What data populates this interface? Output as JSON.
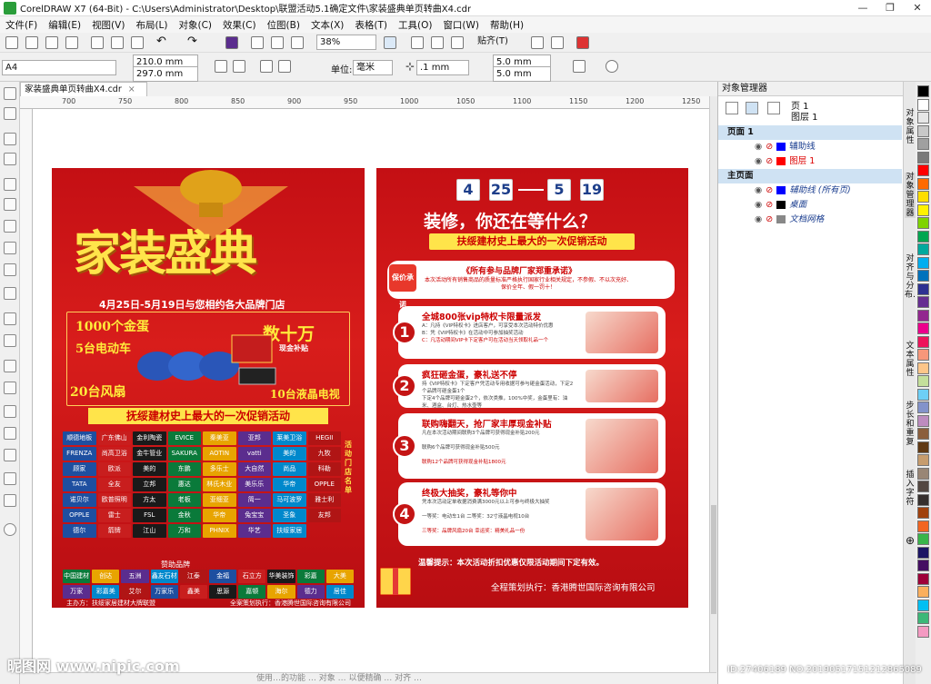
{
  "window": {
    "title": "CorelDRAW X7 (64-Bit) - C:\\Users\\Administrator\\Desktop\\联盟活动5.1确定文件\\家装盛典单页转曲X4.cdr",
    "minimize": "—",
    "restore": "❐",
    "close": "✕"
  },
  "menu": [
    "文件(F)",
    "编辑(E)",
    "视图(V)",
    "布局(L)",
    "对象(C)",
    "效果(C)",
    "位图(B)",
    "文本(X)",
    "表格(T)",
    "工具(O)",
    "窗口(W)",
    "帮助(H)"
  ],
  "toolbar": {
    "zoom": "38%",
    "snap": "贴齐(T)"
  },
  "propbar": {
    "page_size": "A4",
    "width": "210.0 mm",
    "height": "297.0 mm",
    "units_label": "单位:",
    "units": "毫米",
    "nudge": ".1 mm",
    "dup_x": "5.0 mm",
    "dup_y": "5.0 mm"
  },
  "document_tab": "家装盛典单页转曲X4.cdr",
  "ruler_ticks": [
    "700",
    "750",
    "800",
    "850",
    "900",
    "950",
    "1000",
    "1050",
    "1100",
    "1150",
    "1200",
    "1250"
  ],
  "status_text": "使用…的功能 … 对象 … 以便精确 … 对齐 …",
  "object_manager": {
    "title": "对象管理器",
    "page_label": "页 1",
    "layer_label": "图层 1",
    "rows": [
      {
        "name": "页面 1",
        "bold": true,
        "selected": true
      },
      {
        "name": "辅助线",
        "color": "#0000ff"
      },
      {
        "name": "图层 1",
        "color": "#ff0000",
        "red": true
      },
      {
        "name": "主页面",
        "bold": true,
        "selected": true
      },
      {
        "name": "辅助线 (所有页)",
        "color": "#0000ff",
        "italic": true
      },
      {
        "name": "桌面",
        "color": "#000000",
        "italic": true
      },
      {
        "name": "文档网格",
        "color": "#888888",
        "italic": true
      }
    ]
  },
  "docker_tabs": [
    "对象属性",
    "对象管理器",
    "对齐与分布…",
    "文本属性",
    "步长和重复",
    "插入字符"
  ],
  "palette": [
    "#000000",
    "#ffffff",
    "#e6e6e6",
    "#c8c8c8",
    "#a0a0a0",
    "#7a7a7a",
    "#ff0000",
    "#ff6a00",
    "#ffde00",
    "#fff200",
    "#7fd400",
    "#00a650",
    "#00a99d",
    "#00aeef",
    "#0072bc",
    "#2e3192",
    "#662d91",
    "#92278f",
    "#ec008c",
    "#ed145b",
    "#f7977a",
    "#fdc689",
    "#c4df9b",
    "#6dcff6",
    "#8393ca",
    "#bd8cbf",
    "#8b5e3c",
    "#603913",
    "#c69c6d",
    "#998675",
    "#534741",
    "#362f2d",
    "#a0410d",
    "#f26522",
    "#39b54a",
    "#1b1464",
    "#440e62",
    "#9e0039",
    "#fbaf5d",
    "#00bff3",
    "#3cb878",
    "#f49ac2"
  ],
  "poster1": {
    "title": "家装盛典",
    "date_line": "4月25日-5月19日与您相约各大品牌门店",
    "prize1": "1000个金蛋",
    "prize2": "5台电动车",
    "prize3": "数十万",
    "prize3b": "现金补贴",
    "prize4": "20台风扇",
    "prize5": "10台液晶电视",
    "banner": "抚绥建材史上最大的一次促销活动",
    "logos": [
      "顺德地板",
      "广东佛山",
      "金利陶瓷",
      "EVICE",
      "秦美亚",
      "亚邦",
      "莱美卫浴",
      "HEGII",
      "FRENZA",
      "尚高卫浴",
      "金牛管业",
      "SAKURA",
      "AOTIN",
      "vatti",
      "美的",
      "九牧",
      "顾家",
      "欧派",
      "美的",
      "东鹏",
      "多乐士",
      "大自然",
      "尚品",
      "科勒",
      "TATA",
      "全友",
      "立邦",
      "惠达",
      "林氏木业",
      "美乐乐",
      "华帝",
      "OPPLE",
      "诺贝尔",
      "欧普照明",
      "方太",
      "老板",
      "亚细亚",
      "简一",
      "马可波罗",
      "雅士利",
      "OPPLE",
      "雷士",
      "FSL",
      "金秋",
      "华帝",
      "兔宝宝",
      "圣象",
      "友邦",
      "德尔",
      "箭牌",
      "江山",
      "万和",
      "PHNIX",
      "华艺",
      "扶绥家居"
    ],
    "vertical_note": "活动门店名单",
    "sponsor_title": "赞助品牌",
    "sponsors": [
      "中国建材",
      "创达",
      "五洲",
      "鑫友石材",
      "江泰",
      "金福",
      "石立方",
      "华美装饰",
      "彩嘉",
      "大美",
      "万家",
      "彩嘉美",
      "艾尔",
      "万家乐",
      "鑫美",
      "思源",
      "嘉顿",
      "海尔",
      "德力",
      "居佳"
    ],
    "footer_left": "主办方：扶绥家居建材大牌联盟",
    "footer_right": "全案策划执行：香港腾世国际咨询有限公司"
  },
  "poster2": {
    "month1": "4",
    "day1": "25",
    "month2": "5",
    "day2": "19",
    "headline": "装修，你还在等什么？",
    "subbanner": "扶绥建材史上最大的一次促销活动",
    "promise_title": "《所有参与品牌厂家郑重承诺》",
    "promise_text": "本次活动所有销售商品的质量标准严格执行国家行业相关规定，不参假、不以次充好、保价全年、假一罚十！",
    "badge": "保价承诺",
    "items": [
      {
        "n": "1",
        "title": "全城800张vip特权卡限量派发",
        "l1": "A：凡持《VIP特权卡》进店客户，可享受本次活动特价优惠",
        "l2": "B：凭《VIP特权卡》在活动中可参加抽奖活动",
        "l3": "C：凡活动期间VIP卡下定客户可在活动当天领取礼品一个"
      },
      {
        "n": "2",
        "title": "疯狂砸金蛋，豪礼送不停",
        "l1": "持《VIP特权卡》下定客户凭活动专用收据可参与砸金蛋活动，下定2个品牌可砸金蛋1个",
        "l2": "下定4个品牌可砸金蛋2个，依次类推，100%中奖，金蛋里有：油米、酒盒、台灯、热水壶等",
        "l3": ""
      },
      {
        "n": "3",
        "title": "联购嗨翻天，抢厂家丰厚现金补贴",
        "l1": "凡在本次活动期间联购3个品牌可获得现金补贴200元",
        "l2": "联购6个品牌可获得现金补贴500元",
        "l3": "联购12个品牌可获得现金补贴1800元"
      },
      {
        "n": "4",
        "title": "终极大抽奖，豪礼等你中",
        "l1": "凭本次活动定单收据消费满3000元以上可参与终极大抽奖",
        "l2": "一等奖：电动车1台  二等奖：32寸液晶电视10台",
        "l3": "三等奖：品牌风扇20台  幸运奖：精美礼品一份"
      }
    ],
    "tip": "温馨提示：本次活动折扣优惠仅限活动期间下定有效。",
    "footer": "全程策划执行：香港腾世国际咨询有限公司"
  },
  "watermark": {
    "site": "昵图网 www.nipic.com",
    "id": "ID:27406189 NO:20190517151212865089"
  }
}
